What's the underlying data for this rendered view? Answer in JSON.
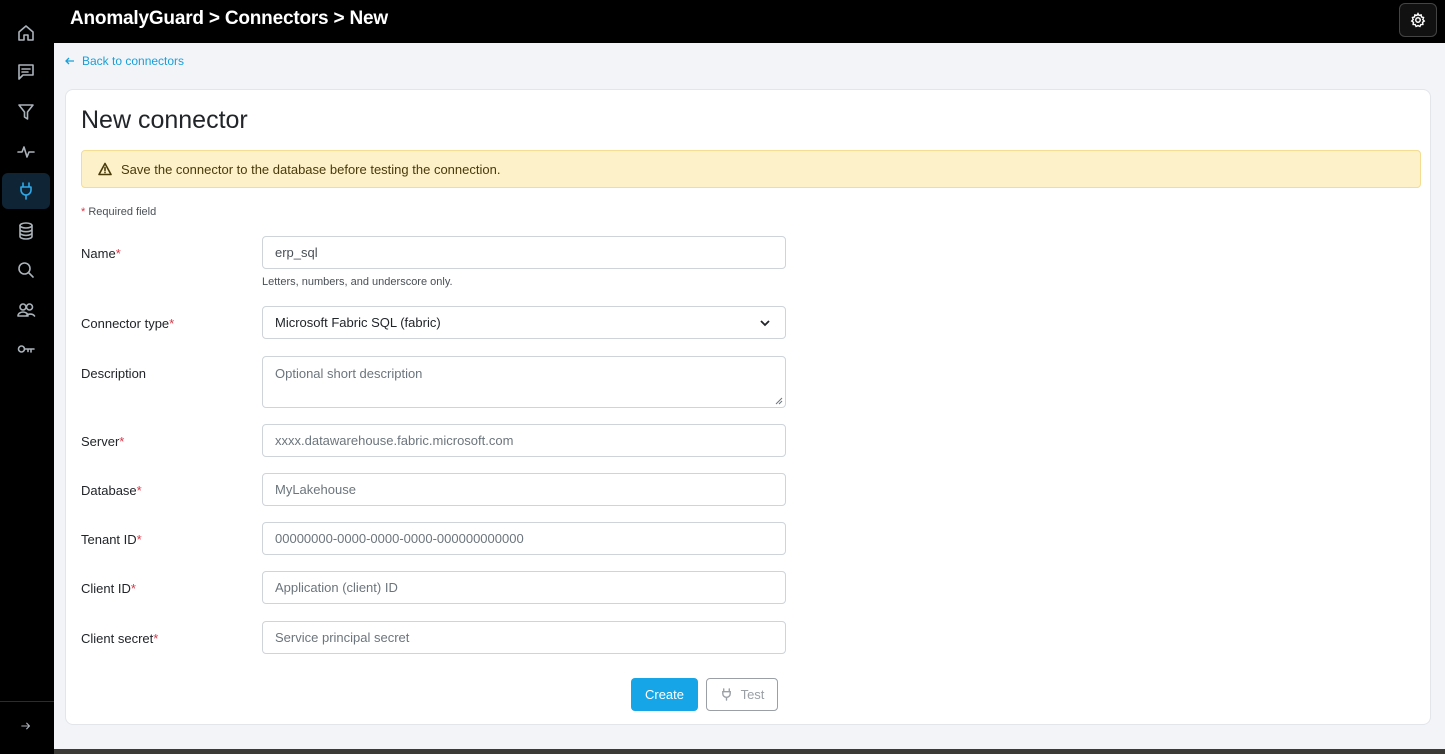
{
  "app": {
    "breadcrumb": "AnomalyGuard > Connectors > New"
  },
  "sidebar": {
    "items": [
      {
        "icon": "home-icon"
      },
      {
        "icon": "messages-icon"
      },
      {
        "icon": "filter-icon"
      },
      {
        "icon": "activity-icon"
      },
      {
        "icon": "plug-icon",
        "active": true
      },
      {
        "icon": "database-icon"
      },
      {
        "icon": "search-icon"
      },
      {
        "icon": "users-icon"
      },
      {
        "icon": "key-icon"
      }
    ],
    "expand_icon": "arrow-right-icon"
  },
  "nav": {
    "back_label": "Back to connectors"
  },
  "form": {
    "title": "New connector",
    "alert_text": "Save the connector to the database before testing the connection.",
    "required_note": "Required field",
    "required_marker": "*",
    "fields": {
      "name": {
        "label": "Name",
        "value": "erp_sql",
        "help": "Letters, numbers, and underscore only."
      },
      "connector_type": {
        "label": "Connector type",
        "value": "Microsoft Fabric SQL (fabric)"
      },
      "description": {
        "label": "Description",
        "placeholder": "Optional short description"
      },
      "server": {
        "label": "Server",
        "placeholder": "xxxx.datawarehouse.fabric.microsoft.com"
      },
      "database": {
        "label": "Database",
        "placeholder": "MyLakehouse"
      },
      "tenant_id": {
        "label": "Tenant ID",
        "placeholder": "00000000-0000-0000-0000-000000000000"
      },
      "client_id": {
        "label": "Client ID",
        "placeholder": "Application (client) ID"
      },
      "client_secret": {
        "label": "Client secret",
        "placeholder": "Service principal secret"
      }
    },
    "create_label": "Create",
    "test_label": "Test"
  },
  "colors": {
    "accent": "#16a5e6",
    "alert_bg": "#fdf1c9",
    "required": "#dc3545"
  }
}
